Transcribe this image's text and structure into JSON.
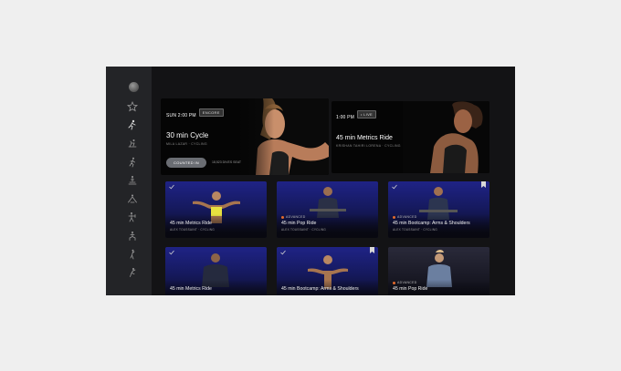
{
  "sidebar": {
    "icons": [
      "profile-avatar-icon",
      "star-icon",
      "all-classes-icon",
      "cycling-icon",
      "running-icon",
      "walking-icon",
      "yoga-icon",
      "strength-icon",
      "stretching-icon",
      "meditation-icon",
      "cardio-icon"
    ]
  },
  "featured": [
    {
      "time": "SUN 2:00 PM",
      "tag": "ENCORE",
      "title": "30 min Cycle",
      "subtitle": "MILA LAZAR · CYCLING",
      "button": "COUNTED IN",
      "meta": "18,523 DIVES SEAT"
    },
    {
      "time": "1:00 PM",
      "tag": "• LIVE",
      "title": "45 min Metrics Ride",
      "subtitle": "KRISHAN TAHIRI LORENA · CYCLING"
    }
  ],
  "classes": [
    {
      "level": "",
      "title": "45 min Metrics Ride",
      "subtitle": "ALEX TOUSSAINT · CYCLING",
      "checked": true,
      "bookmarked": false
    },
    {
      "level": "ADVANCED",
      "title": "45 min Pop Ride",
      "subtitle": "ALEX TOUSSAINT · CYCLING",
      "checked": false,
      "bookmarked": false
    },
    {
      "level": "ADVANCED",
      "title": "45 min Bootcamp: Arms & Shoulders",
      "subtitle": "ALEX TOUSSAINT · CYCLING",
      "checked": true,
      "bookmarked": true
    },
    {
      "level": "",
      "title": "45 min Metrics Ride",
      "subtitle": "",
      "checked": true,
      "bookmarked": false
    },
    {
      "level": "",
      "title": "45 min Bootcamp: Arms & Shoulders",
      "subtitle": "",
      "checked": true,
      "bookmarked": true
    },
    {
      "level": "ADVANCED",
      "title": "45 min Pop Ride",
      "subtitle": "",
      "checked": false,
      "bookmarked": false
    }
  ],
  "colors": {
    "accent_orange": "#e26a2c",
    "sidebar_bg": "#232427",
    "main_bg": "#131315",
    "card_blue": "#1f2386"
  }
}
